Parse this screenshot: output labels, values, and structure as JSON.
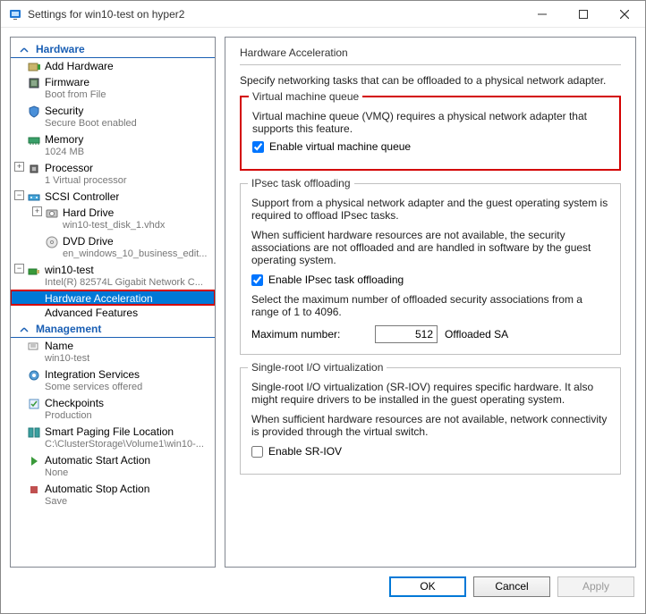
{
  "window": {
    "title": "Settings for win10-test on hyper2"
  },
  "sections": {
    "hardware": "Hardware",
    "management": "Management"
  },
  "tree": {
    "add_hardware": "Add Hardware",
    "firmware": "Firmware",
    "firmware_sub": "Boot from File",
    "security": "Security",
    "security_sub": "Secure Boot enabled",
    "memory": "Memory",
    "memory_sub": "1024 MB",
    "processor": "Processor",
    "processor_sub": "1 Virtual processor",
    "scsi": "SCSI Controller",
    "hard_drive": "Hard Drive",
    "hard_drive_sub": "win10-test_disk_1.vhdx",
    "dvd": "DVD Drive",
    "dvd_sub": "en_windows_10_business_edit...",
    "nic": "win10-test",
    "nic_sub": "Intel(R) 82574L Gigabit Network C...",
    "hw_accel": "Hardware Acceleration",
    "adv_feat": "Advanced Features",
    "name": "Name",
    "name_sub": "win10-test",
    "integration": "Integration Services",
    "integration_sub": "Some services offered",
    "checkpoints": "Checkpoints",
    "checkpoints_sub": "Production",
    "paging": "Smart Paging File Location",
    "paging_sub": "C:\\ClusterStorage\\Volume1\\win10-...",
    "auto_start": "Automatic Start Action",
    "auto_start_sub": "None",
    "auto_stop": "Automatic Stop Action",
    "auto_stop_sub": "Save"
  },
  "detail": {
    "title": "Hardware Acceleration",
    "intro": "Specify networking tasks that can be offloaded to a physical network adapter.",
    "vmq": {
      "legend": "Virtual machine queue",
      "desc": "Virtual machine queue (VMQ) requires a physical network adapter that supports this feature.",
      "checkbox": "Enable virtual machine queue",
      "checked": true
    },
    "ipsec": {
      "legend": "IPsec task offloading",
      "desc1": "Support from a physical network adapter and the guest operating system is required to offload IPsec tasks.",
      "desc2": "When sufficient hardware resources are not available, the security associations are not offloaded and are handled in software by the guest operating system.",
      "checkbox": "Enable IPsec task offloading",
      "checked": true,
      "select_desc": "Select the maximum number of offloaded security associations from a range of 1 to 4096.",
      "max_label": "Maximum number:",
      "max_value": "512",
      "max_suffix": "Offloaded SA"
    },
    "sriov": {
      "legend": "Single-root I/O virtualization",
      "desc1": "Single-root I/O virtualization (SR-IOV) requires specific hardware. It also might require drivers to be installed in the guest operating system.",
      "desc2": "When sufficient hardware resources are not available, network connectivity is provided through the virtual switch.",
      "checkbox": "Enable SR-IOV",
      "checked": false
    }
  },
  "buttons": {
    "ok": "OK",
    "cancel": "Cancel",
    "apply": "Apply"
  }
}
